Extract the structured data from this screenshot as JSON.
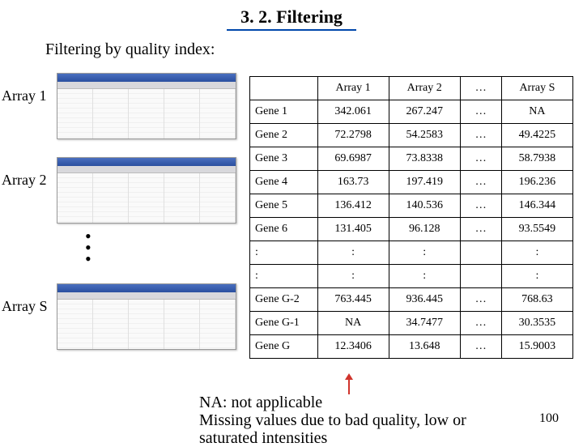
{
  "title": "3. 2. Filtering",
  "subtitle": "Filtering by quality index:",
  "leftLabels": {
    "a1": "Array 1",
    "a2": "Array 2",
    "as": "Array S"
  },
  "table": {
    "headers": [
      "",
      "Array 1",
      "Array 2",
      "…",
      "Array S"
    ],
    "rows": [
      {
        "label": "Gene 1",
        "a1": "342.061",
        "a2": "267.247",
        "d": "…",
        "as": "NA"
      },
      {
        "label": "Gene 2",
        "a1": "72.2798",
        "a2": "54.2583",
        "d": "…",
        "as": "49.4225"
      },
      {
        "label": "Gene 3",
        "a1": "69.6987",
        "a2": "73.8338",
        "d": "…",
        "as": "58.7938"
      },
      {
        "label": "Gene 4",
        "a1": "163.73",
        "a2": "197.419",
        "d": "…",
        "as": "196.236"
      },
      {
        "label": "Gene 5",
        "a1": "136.412",
        "a2": "140.536",
        "d": "…",
        "as": "146.344"
      },
      {
        "label": "Gene 6",
        "a1": "131.405",
        "a2": "96.128",
        "d": "…",
        "as": "93.5549"
      },
      {
        "label": ":",
        "a1": ":",
        "a2": ":",
        "d": "",
        "as": ":"
      },
      {
        "label": ":",
        "a1": ":",
        "a2": ":",
        "d": "",
        "as": ":"
      },
      {
        "label": "Gene G-2",
        "a1": "763.445",
        "a2": "936.445",
        "d": "…",
        "as": "768.63"
      },
      {
        "label": "Gene G-1",
        "a1": "NA",
        "a2": "34.7477",
        "d": "…",
        "as": "30.3535"
      },
      {
        "label": "Gene G",
        "a1": "12.3406",
        "a2": "13.648",
        "d": "…",
        "as": "15.9003"
      }
    ]
  },
  "footer": {
    "line1": "NA: not applicable",
    "line2": "Missing values due to bad quality, low or",
    "line3": "saturated intensities"
  },
  "pageNumber": "100"
}
